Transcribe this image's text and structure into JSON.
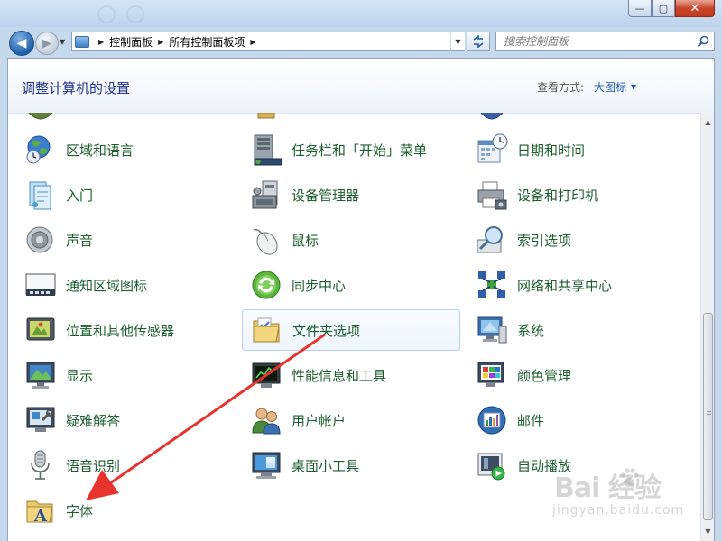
{
  "window": {
    "caption_buttons": {
      "minimize_glyph": "—",
      "maximize_glyph": "▢",
      "close_glyph": "✕"
    }
  },
  "nav": {
    "back_glyph": "◀",
    "forward_glyph": "▶",
    "breadcrumbs": [
      "控制面板",
      "所有控制面板项"
    ],
    "crumb_separator": "▶",
    "refresh_glyph": "↻",
    "search_placeholder": "搜索控制面板"
  },
  "header": {
    "title": "调整计算机的设置",
    "view_label": "查看方式:",
    "view_value": "大图标"
  },
  "items": [
    {
      "label": "区域和语言",
      "icon": "globe-clock-icon"
    },
    {
      "label": "任务栏和「开始」菜单",
      "icon": "taskbar-icon"
    },
    {
      "label": "日期和时间",
      "icon": "calendar-clock-icon"
    },
    {
      "label": "入门",
      "icon": "getting-started-icon"
    },
    {
      "label": "设备管理器",
      "icon": "device-manager-icon"
    },
    {
      "label": "设备和打印机",
      "icon": "printer-icon"
    },
    {
      "label": "声音",
      "icon": "speaker-icon"
    },
    {
      "label": "鼠标",
      "icon": "mouse-icon"
    },
    {
      "label": "索引选项",
      "icon": "index-search-icon"
    },
    {
      "label": "通知区域图标",
      "icon": "notification-area-icon"
    },
    {
      "label": "同步中心",
      "icon": "sync-icon"
    },
    {
      "label": "网络和共享中心",
      "icon": "network-icon"
    },
    {
      "label": "位置和其他传感器",
      "icon": "sensor-icon"
    },
    {
      "label": "文件夹选项",
      "icon": "folder-options-icon",
      "selected": true
    },
    {
      "label": "系统",
      "icon": "system-icon"
    },
    {
      "label": "显示",
      "icon": "display-icon"
    },
    {
      "label": "性能信息和工具",
      "icon": "performance-icon"
    },
    {
      "label": "颜色管理",
      "icon": "color-management-icon"
    },
    {
      "label": "疑难解答",
      "icon": "troubleshooting-icon"
    },
    {
      "label": "用户帐户",
      "icon": "user-accounts-icon"
    },
    {
      "label": "邮件",
      "icon": "mail-icon"
    },
    {
      "label": "语音识别",
      "icon": "microphone-icon"
    },
    {
      "label": "桌面小工具",
      "icon": "gadgets-icon"
    },
    {
      "label": "自动播放",
      "icon": "autoplay-icon"
    },
    {
      "label": "字体",
      "icon": "fonts-icon"
    }
  ],
  "watermark": {
    "main": "Bai  经验",
    "sub": "jingyan.baidu.com"
  },
  "colors": {
    "item_label": "#1b5d2e",
    "title": "#1e3287",
    "link": "#1a5ab4",
    "annotation_arrow": "#e8322c"
  }
}
